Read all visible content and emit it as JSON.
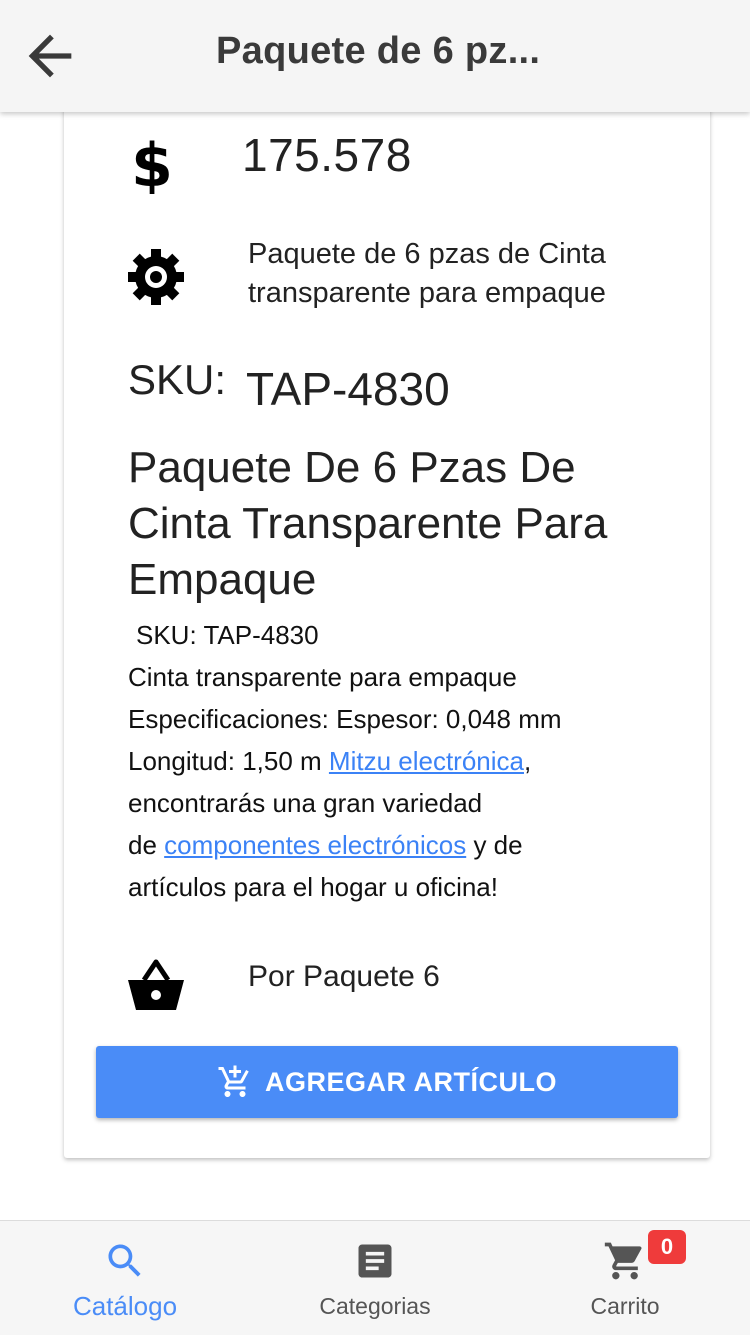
{
  "header": {
    "title": "Paquete de 6 pz...",
    "back_icon": "arrow-left-icon"
  },
  "product": {
    "price": "175.578",
    "price_icon": "dollar-icon",
    "short_description": "Paquete de 6 pzas de Cinta transparente para empaque",
    "description_icon": "gear-icon",
    "sku_label": "SKU:",
    "sku_value": "TAP-4830",
    "title": "Paquete De 6 Pzas De Cinta Transparente Para Empaque",
    "details": {
      "sku_line": "SKU: TAP-4830",
      "line1": "Cinta transparente para empaque",
      "line2": "Especificaciones: Espesor: 0,048 mm",
      "line3_prefix": "Longitud: 1,50 m ",
      "link1": "Mitzu electrónica",
      "line3_suffix": ",",
      "line4": "encontrarás una gran variedad",
      "line5_prefix": "de ",
      "link2": "componentes electrónicos",
      "line5_suffix": " y de",
      "line6": "artículos para el hogar u oficina!"
    },
    "unit_icon": "basket-icon",
    "unit": "Por Paquete 6"
  },
  "add_button": {
    "label": "AGREGAR ARTÍCULO",
    "icon": "add-cart-icon"
  },
  "bottom_nav": {
    "items": [
      {
        "label": "Catálogo",
        "icon": "search-icon",
        "active": true
      },
      {
        "label": "Categorias",
        "icon": "list-icon",
        "active": false
      },
      {
        "label": "Carrito",
        "icon": "cart-icon",
        "active": false
      }
    ],
    "cart_badge": "0"
  },
  "colors": {
    "accent": "#4a8cf7",
    "link": "#3b82f6",
    "badge": "#ef3b3b",
    "appbar": "#f5f5f5"
  }
}
